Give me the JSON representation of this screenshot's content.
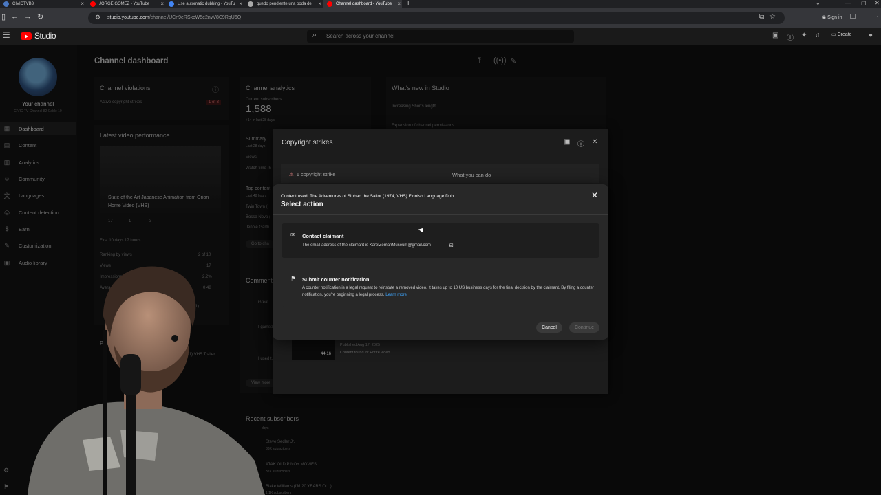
{
  "browser": {
    "tabs": [
      {
        "title": "CIVICTVB3",
        "fav": "#4a78c2"
      },
      {
        "title": "JORGE GOMEZ - YouTube",
        "fav": "#ff0000"
      },
      {
        "title": "Use automatic dubbing - YouTu",
        "fav": "#4285f4"
      },
      {
        "title": "quedo pendiente una boda de",
        "fav": "#aaaaaa"
      },
      {
        "title": "Channel dashboard - YouTube",
        "fav": "#ff0000"
      }
    ],
    "new_tab": "+",
    "url_host": "studio.youtube.com",
    "url_path": "/channel/UCn9eRSkcW5e2nvV8C9RqU6Q",
    "signin": "Sign in"
  },
  "studio": {
    "logo_text": "Studio",
    "search_placeholder": "Search across your channel",
    "create_label": "Create"
  },
  "sidebar": {
    "your_channel": "Your channel",
    "channel_subtitle": "CIVIC TV Channel 82 Cable 10",
    "items": [
      {
        "label": "Dashboard",
        "icon": "dashboard-icon"
      },
      {
        "label": "Content",
        "icon": "content-icon"
      },
      {
        "label": "Analytics",
        "icon": "analytics-icon"
      },
      {
        "label": "Community",
        "icon": "community-icon"
      },
      {
        "label": "Languages",
        "icon": "languages-icon"
      },
      {
        "label": "Content detection",
        "icon": "content-detection-icon"
      },
      {
        "label": "Earn",
        "icon": "earn-icon"
      },
      {
        "label": "Customization",
        "icon": "customization-icon"
      },
      {
        "label": "Audio library",
        "icon": "audio-library-icon"
      }
    ]
  },
  "dashboard": {
    "title": "Channel dashboard",
    "violations": {
      "title": "Channel violations",
      "active_label": "Active copyright strikes",
      "badge": "1 of 3"
    },
    "latest_video": {
      "title": "Latest video performance",
      "video_title": "State of the Art Japanese Animation from Orion Home Video (VHS)",
      "likes": "17",
      "comments": "1",
      "dislikes": "3",
      "first_days": "First 10 days 17 hours",
      "ranking_label": "Ranking by views",
      "ranking_value": "2 of 10",
      "views_label": "Views",
      "views_value": "17",
      "impressions_label": "Impressions...",
      "impressions_value": "2.2%",
      "avg_label": "Avera...",
      "avg_value": "0:48"
    },
    "analytics": {
      "title": "Channel analytics",
      "subs_label": "Current subscribers",
      "subs_value": "1,588",
      "subs_change": "+14 in last 28 days",
      "summary": "Summary",
      "summary_period": "Last 28 days",
      "views": "Views",
      "watch_time": "Watch time (h",
      "top_content": "Top content",
      "top_period": "Last 48 hours",
      "items": [
        "Twin Town (",
        "Bossa Nova (",
        "Jennie Garth"
      ],
      "go_to": "Go to cha"
    },
    "whats_new": {
      "title": "What's new in Studio",
      "items": [
        "Increasing Shorts length",
        "Expansion of channel permissions"
      ]
    },
    "comments": {
      "title": "Comments",
      "c1": "Great...",
      "c2": "I gained... video.",
      "c3": "I used t... wore o",
      "view_more": "View more"
    },
    "published_label": "Pub...",
    "vhs_trailer": "ode 2 (2001) VHS Trailer",
    "comments_count": "nts (1)",
    "recent_subs": {
      "title": "Recent subscribers",
      "period": "days",
      "s1": "Steve Sedler Jr.",
      "s1_sub": "36K subscribers",
      "s2": "ATAK OLD PINOY MOVIES",
      "s2_sub": "37K subscribers",
      "s3": "Blake Williams (I'M 20 YEARS OL..)",
      "s3_sub": "1.1K subscribers"
    }
  },
  "strikes_panel": {
    "title": "Copyright strikes",
    "strike_count": "1 copyright strike",
    "what_you_can_do": "What you can do",
    "published": "Published Aug 17, 2025",
    "found_in": "Content found in: Entire video",
    "duration": "44:16"
  },
  "dialog": {
    "content_used": "Content used: The Adventures of Sinbad the Sailor (1974, VHS) Finnish Language Dub",
    "title": "Select action",
    "contact": {
      "title": "Contact claimant",
      "desc": "The email address of the claimant is KarelZemanMuseum@gmail.com"
    },
    "counter": {
      "title": "Submit counter notification",
      "desc": "A counter notification is a legal request to reinstate a removed video. It takes up to 10 US business days for the final decision by the claimant. By filing a counter notification, you're beginning a legal process.",
      "learn_more": "Learn more"
    },
    "cancel": "Cancel",
    "continue": "Continue"
  }
}
